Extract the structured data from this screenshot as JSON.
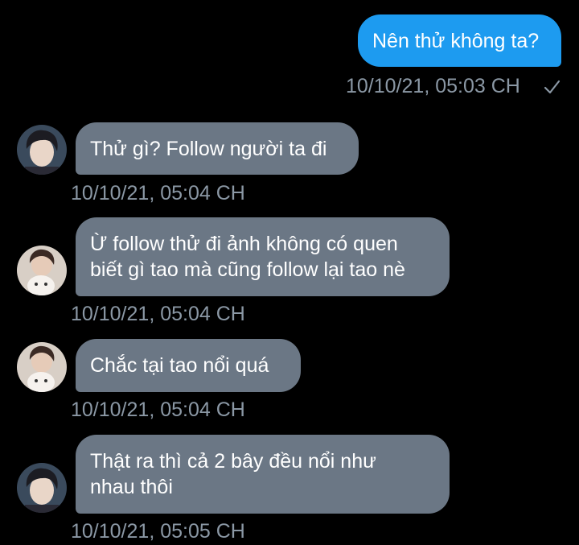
{
  "conversation": {
    "messages": [
      {
        "from": "me",
        "text": "Nên thử không ta?",
        "timestamp": "10/10/21, 05:03 CH",
        "status": "check-icon"
      },
      {
        "from": "other",
        "text": "Thử gì? Follow người ta đi",
        "timestamp": "10/10/21, 05:04 CH",
        "avatar": "avatar-boy-dark-hair"
      },
      {
        "from": "other",
        "text": "Ừ follow thử đi ảnh không có quen\nbiết gì tao mà cũng follow lại tao nè",
        "timestamp": "10/10/21, 05:04 CH",
        "avatar": "avatar-boy-with-plush"
      },
      {
        "from": "other",
        "text": "Chắc tại tao nổi quá",
        "timestamp": "10/10/21, 05:04 CH",
        "avatar": "avatar-boy-with-plush"
      },
      {
        "from": "other",
        "text": "Thật ra thì cả 2 bây đều nổi như\nnhau thôi",
        "timestamp": "10/10/21, 05:05 CH",
        "avatar": "avatar-boy-dark-hair"
      }
    ]
  },
  "colors": {
    "background": "#000000",
    "sent_bubble": "#1d9bf0",
    "received_bubble": "#6b7785",
    "timestamp": "#8b98a5"
  }
}
